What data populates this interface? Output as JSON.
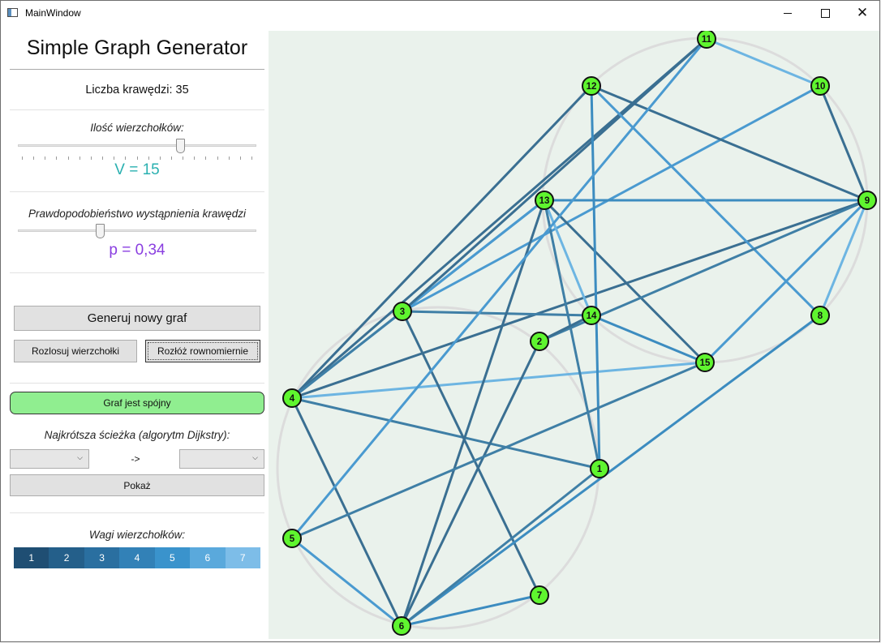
{
  "window": {
    "title": "MainWindow",
    "minimize_icon": "minimize-icon",
    "maximize_icon": "maximize-icon",
    "close_icon": "close-icon",
    "close_glyph": "✕"
  },
  "panel": {
    "app_title": "Simple Graph Generator",
    "edge_count_text": "Liczba krawędzi: 35",
    "vertices_label": "Ilość wierzchołków:",
    "vertices_value_text": "V = 15",
    "vertices_slider_level": 0.69,
    "vertices_color": "#2ab0b0",
    "probability_label": "Prawdopodobieństwo wystąpnienia krawędzi",
    "probability_value_text": "p = 0,34",
    "probability_slider_level": 0.34,
    "probability_color": "#8a3ee0",
    "generate_button": "Generuj nowy graf",
    "randomize_button": "Rozlosuj wierzchołki",
    "even_layout_button": "Rozłóż rownomiernie",
    "status_text": "Graf jest spójny",
    "status_color": "#90ee90",
    "dijkstra_label": "Najkrótsza ścieżka (algorytm Dijkstry):",
    "from_select": "",
    "arrow_text": "->",
    "to_select": "",
    "show_button": "Pokaż",
    "weights_label": "Wagi wierzchołków:",
    "weights": [
      {
        "label": "1",
        "color": "#1f4e73"
      },
      {
        "label": "2",
        "color": "#245f8a"
      },
      {
        "label": "3",
        "color": "#2a6fa0"
      },
      {
        "label": "4",
        "color": "#3281b7"
      },
      {
        "label": "5",
        "color": "#3a93cc"
      },
      {
        "label": "6",
        "color": "#5aa9dc"
      },
      {
        "label": "7",
        "color": "#7dbde8"
      }
    ]
  },
  "graph": {
    "background": "#eaf2ec",
    "node_fill": "#5ff52f",
    "nodes": [
      "1",
      "2",
      "3",
      "4",
      "5",
      "6",
      "7",
      "8",
      "9",
      "10",
      "11",
      "12",
      "13",
      "14",
      "15"
    ],
    "edges": [
      {
        "from": "4",
        "to": "11",
        "weight": 2
      },
      {
        "from": "4",
        "to": "12",
        "weight": 2
      },
      {
        "from": "4",
        "to": "13",
        "weight": 4
      },
      {
        "from": "4",
        "to": "3",
        "weight": 3
      },
      {
        "from": "4",
        "to": "9",
        "weight": 2
      },
      {
        "from": "4",
        "to": "15",
        "weight": 6
      },
      {
        "from": "4",
        "to": "1",
        "weight": 3
      },
      {
        "from": "4",
        "to": "6",
        "weight": 2
      },
      {
        "from": "3",
        "to": "13",
        "weight": 5
      },
      {
        "from": "3",
        "to": "10",
        "weight": 5
      },
      {
        "from": "3",
        "to": "14",
        "weight": 3
      },
      {
        "from": "3",
        "to": "7",
        "weight": 2
      },
      {
        "from": "3",
        "to": "11",
        "weight": 2
      },
      {
        "from": "13",
        "to": "9",
        "weight": 4
      },
      {
        "from": "13",
        "to": "14",
        "weight": 6
      },
      {
        "from": "13",
        "to": "15",
        "weight": 2
      },
      {
        "from": "13",
        "to": "6",
        "weight": 2
      },
      {
        "from": "13",
        "to": "1",
        "weight": 3
      },
      {
        "from": "12",
        "to": "9",
        "weight": 2
      },
      {
        "from": "12",
        "to": "1",
        "weight": 4
      },
      {
        "from": "12",
        "to": "8",
        "weight": 5
      },
      {
        "from": "11",
        "to": "10",
        "weight": 6
      },
      {
        "from": "11",
        "to": "5",
        "weight": 5
      },
      {
        "from": "10",
        "to": "9",
        "weight": 2
      },
      {
        "from": "9",
        "to": "15",
        "weight": 5
      },
      {
        "from": "9",
        "to": "2",
        "weight": 3
      },
      {
        "from": "9",
        "to": "8",
        "weight": 6
      },
      {
        "from": "14",
        "to": "15",
        "weight": 4
      },
      {
        "from": "2",
        "to": "14",
        "weight": 2
      },
      {
        "from": "2",
        "to": "6",
        "weight": 2
      },
      {
        "from": "15",
        "to": "5",
        "weight": 3
      },
      {
        "from": "8",
        "to": "6",
        "weight": 4
      },
      {
        "from": "1",
        "to": "6",
        "weight": 3
      },
      {
        "from": "5",
        "to": "6",
        "weight": 5
      },
      {
        "from": "6",
        "to": "7",
        "weight": 4
      }
    ]
  }
}
